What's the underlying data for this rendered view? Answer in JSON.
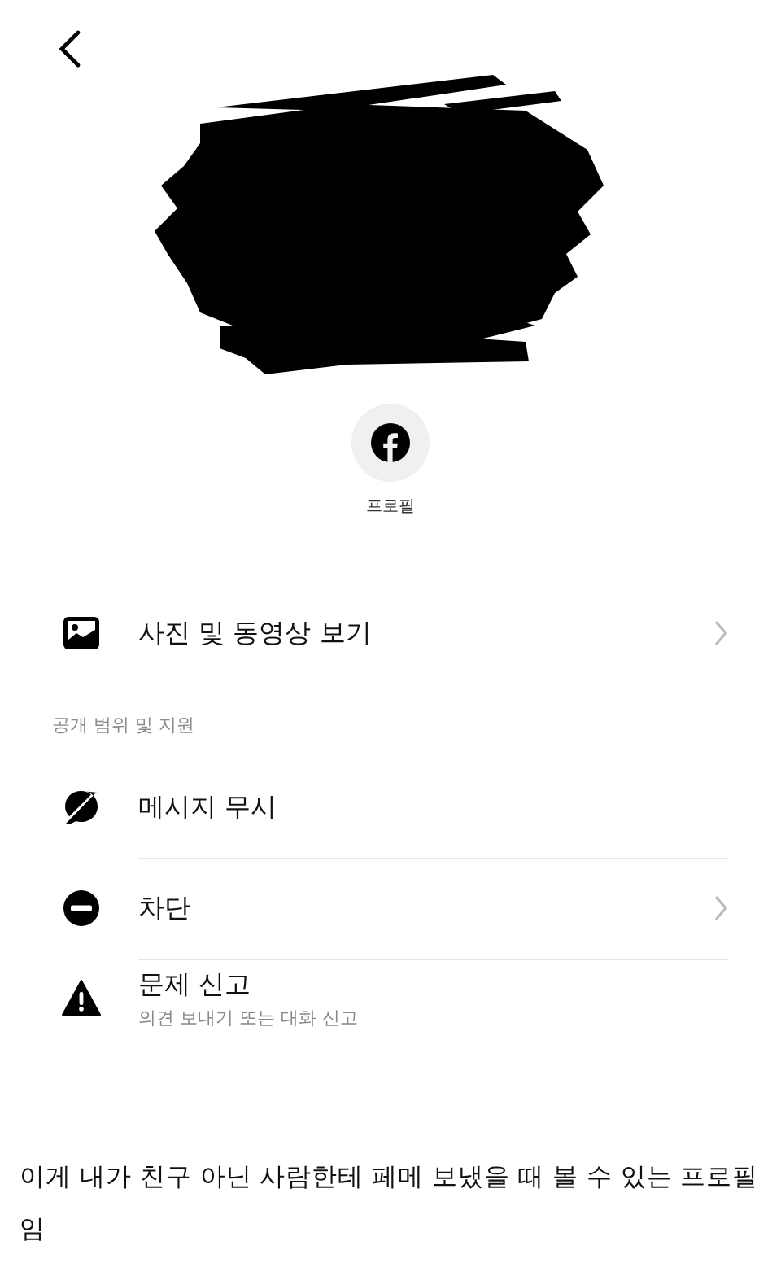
{
  "profile_button": {
    "label": "프로필"
  },
  "top_items": [
    {
      "label": "사진 및 동영상 보기",
      "chevron": true
    }
  ],
  "section": {
    "title": "공개 범위 및 지원",
    "items": [
      {
        "label": "메시지 무시",
        "chevron": false
      },
      {
        "label": "차단",
        "chevron": true
      },
      {
        "label": "문제 신고",
        "subtitle": "의견 보내기 또는 대화 신고",
        "chevron": false
      }
    ]
  },
  "caption": "이게 내가 친구 아닌 사람한테 페메 보냈을 때 볼 수 있는 프로필 임"
}
